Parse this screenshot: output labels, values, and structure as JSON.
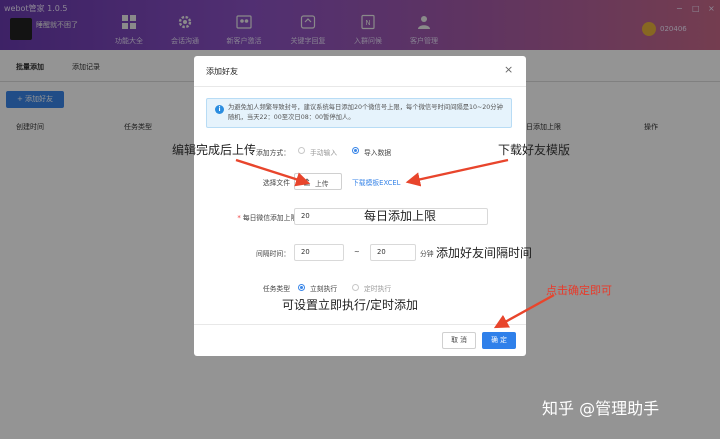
{
  "app": {
    "title": "webot管家 1.0.5",
    "username": "睡醒就不困了",
    "user_account": "020406",
    "window_controls": [
      "−",
      "□",
      "×"
    ]
  },
  "nav": [
    {
      "label": "功能大全",
      "icon": "grid-icon"
    },
    {
      "label": "会话沟通",
      "icon": "gear-icon"
    },
    {
      "label": "新客户激活",
      "icon": "people-icon"
    },
    {
      "label": "关键字回复",
      "icon": "chat-icon"
    },
    {
      "label": "入群问候",
      "icon": "doc-icon"
    },
    {
      "label": "客户管理",
      "icon": "user-icon"
    }
  ],
  "tabs": [
    {
      "label": "批量添加",
      "active": true
    },
    {
      "label": "添加记录",
      "active": false
    }
  ],
  "toolbar": {
    "add_friend": "+ 添加好友"
  },
  "table": {
    "headers": [
      "创建时间",
      "任务类型",
      "日添加上限",
      "操作"
    ]
  },
  "dialog": {
    "title": "添加好友",
    "close": "×",
    "notice": "为避免加人频繁导致封号，建议系统每日添加20个微信号上限，每个微信号时间间隔是10~20分钟随机，当天22：00至次日08：00暂停加人。",
    "method_label": "添加方式：",
    "method_options": [
      {
        "label": "手动输入",
        "selected": false
      },
      {
        "label": "导入数据",
        "selected": true
      }
    ],
    "file_label": "选择文件",
    "upload_label": "上传",
    "template_link": "下载模板EXCEL",
    "daily_limit_label": "每日微信添加上限：",
    "daily_limit_value": "20",
    "interval_label": "间隔时间：",
    "interval_min": "20",
    "interval_sep": "~",
    "interval_max": "20",
    "interval_unit": "分钟",
    "task_type_label": "任务类型",
    "task_options": [
      {
        "label": "立刻执行",
        "selected": true
      },
      {
        "label": "定时执行",
        "selected": false
      }
    ],
    "cancel": "取 消",
    "confirm": "确 定"
  },
  "annotations": {
    "upload_hint": "编辑完成后上传",
    "download_hint": "下载好友模版",
    "daily_hint": "每日添加上限",
    "interval_hint": "添加好友间隔时间",
    "task_hint": "可设置立即执行/定时添加",
    "confirm_hint": "点击确定即可"
  },
  "watermark": "知乎 @管理助手",
  "colors": {
    "accent": "#2f80ea",
    "annotation_red": "#e83a2a",
    "header_start": "#6a3bb0",
    "header_end": "#c86a8a"
  }
}
